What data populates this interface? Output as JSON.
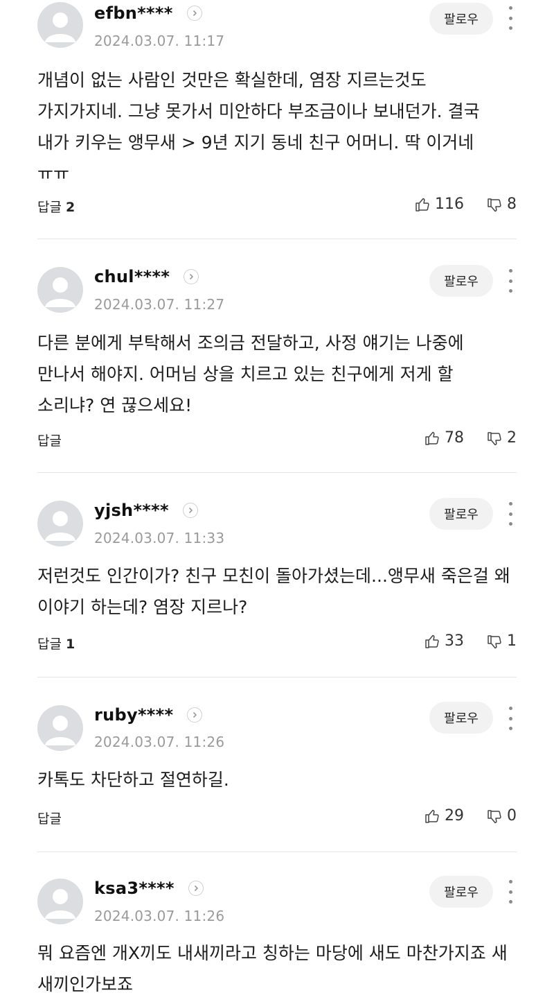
{
  "follow_label": "팔로우",
  "reply_label": "답글",
  "comments": [
    {
      "nickname": "efbn****",
      "date": "2024.03.07. 11:17",
      "text": "개념이 없는 사람인 것만은 확실한데, 염장 지르는것도 가지가지네. 그냥 못가서 미안하다 부조금이나 보내던가. 결국 내가 키우는 앵무새 > 9년 지기 동네 친구 어머니. 딱 이거네 ㅠㅠ",
      "replies": "2",
      "likes": "116",
      "dislikes": "8"
    },
    {
      "nickname": "chul****",
      "date": "2024.03.07. 11:27",
      "text": "다른 분에게 부탁해서 조의금 전달하고, 사정 얘기는 나중에 만나서 해야지. 어머님 상을 치르고 있는 친구에게 저게 할 소리냐? 연 끊으세요!",
      "replies": "",
      "likes": "78",
      "dislikes": "2"
    },
    {
      "nickname": "yjsh****",
      "date": "2024.03.07. 11:33",
      "text": "저런것도 인간이가? 친구 모친이 돌아가셨는데...앵무새 죽은걸 왜 이야기 하는데? 염장 지르나?",
      "replies": "1",
      "likes": "33",
      "dislikes": "1"
    },
    {
      "nickname": "ruby****",
      "date": "2024.03.07. 11:26",
      "text": "카톡도 차단하고 절연하길.",
      "replies": "",
      "likes": "29",
      "dislikes": "0"
    },
    {
      "nickname": "ksa3****",
      "date": "2024.03.07. 11:26",
      "text": "뭐 요즘엔 개X끼도 내새끼라고 칭하는 마당에 새도 마찬가지죠 새 새끼인가보죠",
      "replies": "",
      "likes": "",
      "dislikes": ""
    }
  ]
}
